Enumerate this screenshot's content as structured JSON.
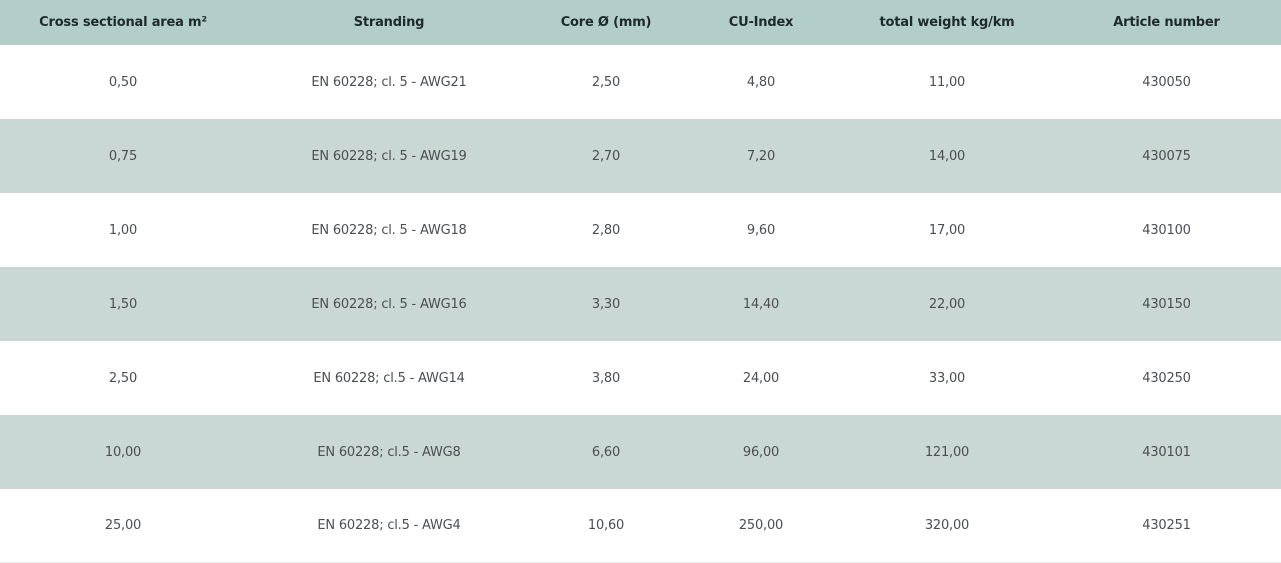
{
  "colors": {
    "header_bg": "#b3cdca",
    "row_alt_bg": "#c9d8d4",
    "row_bg": "#ffffff"
  },
  "table": {
    "headers": [
      "Cross sectional area m²",
      "Stranding",
      "Core Ø (mm)",
      "CU-Index",
      "total weight kg/km",
      "Article number"
    ],
    "rows": [
      [
        "0,50",
        "EN 60228; cl. 5 - AWG21",
        "2,50",
        "4,80",
        "11,00",
        "430050"
      ],
      [
        "0,75",
        "EN 60228; cl. 5 - AWG19",
        "2,70",
        "7,20",
        "14,00",
        "430075"
      ],
      [
        "1,00",
        "EN 60228; cl. 5 - AWG18",
        "2,80",
        "9,60",
        "17,00",
        "430100"
      ],
      [
        "1,50",
        "EN 60228; cl. 5 - AWG16",
        "3,30",
        "14,40",
        "22,00",
        "430150"
      ],
      [
        "2,50",
        "EN 60228; cl.5 - AWG14",
        "3,80",
        "24,00",
        "33,00",
        "430250"
      ],
      [
        "10,00",
        "EN 60228; cl.5 - AWG8",
        "6,60",
        "96,00",
        "121,00",
        "430101"
      ],
      [
        "25,00",
        "EN 60228; cl.5 - AWG4",
        "10,60",
        "250,00",
        "320,00",
        "430251"
      ]
    ]
  }
}
